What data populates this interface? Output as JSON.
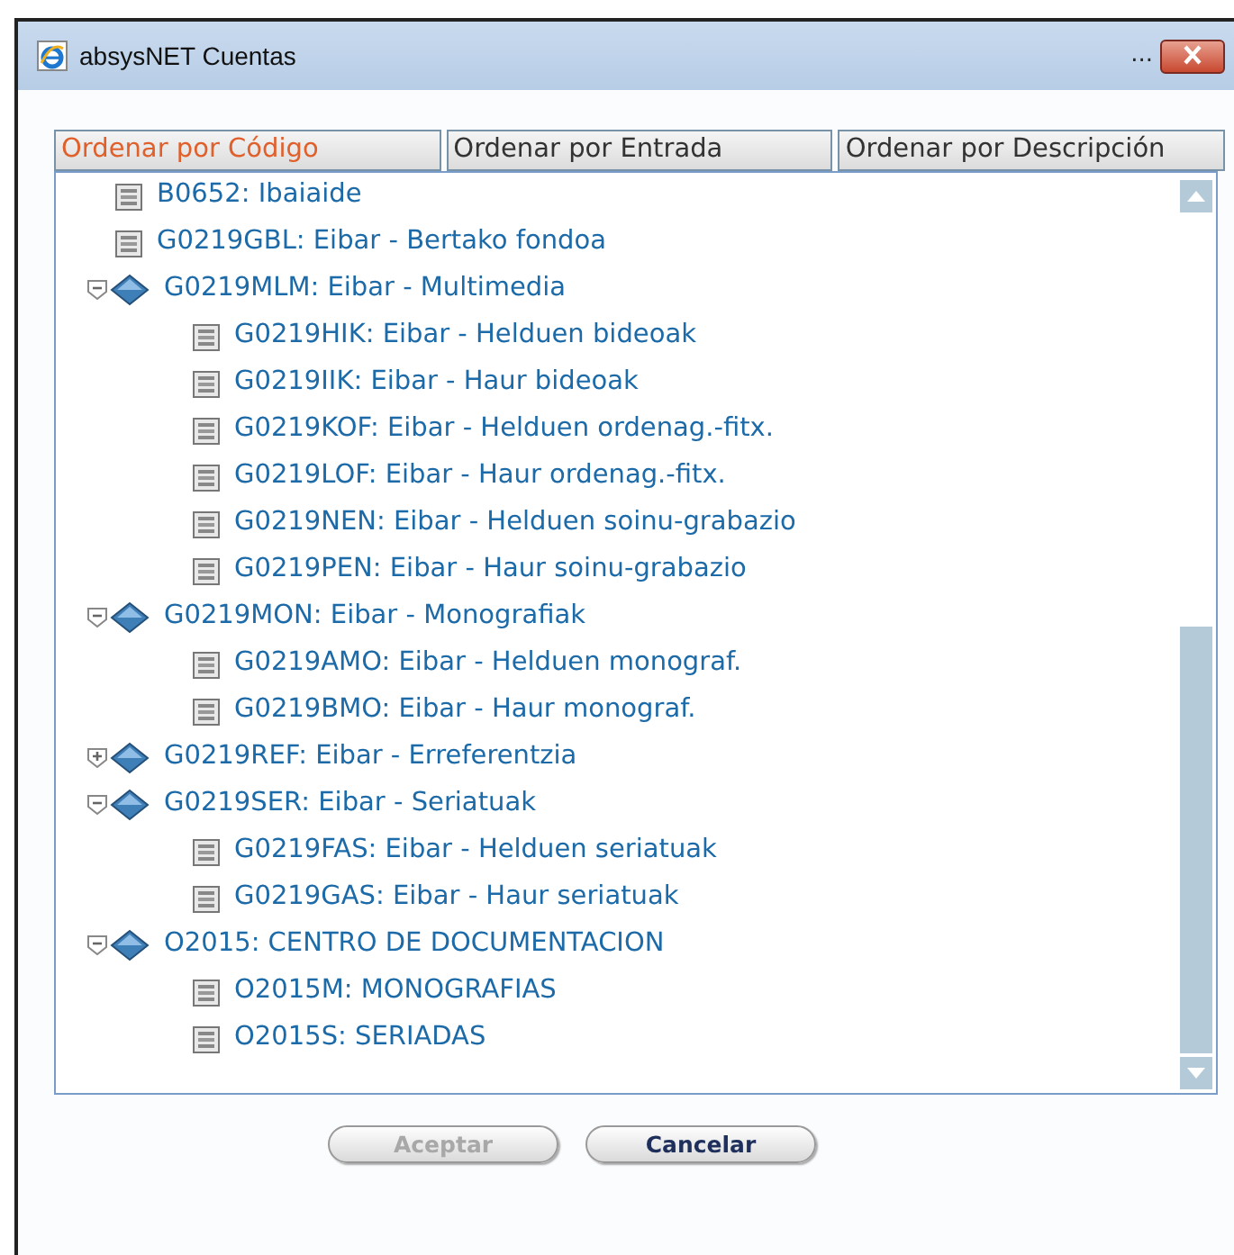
{
  "window": {
    "title": "absysNET Cuentas",
    "ellipsis": "..."
  },
  "tabs": [
    {
      "label": "Ordenar por Código",
      "selected": true
    },
    {
      "label": "Ordenar por Entrada",
      "selected": false
    },
    {
      "label": "Ordenar por Descripción",
      "selected": false
    }
  ],
  "tree": [
    {
      "label": "B0652: Ibaiaide",
      "kind": "leaf"
    },
    {
      "label": "G0219GBL: Eibar - Bertako fondoa",
      "kind": "leaf"
    },
    {
      "label": "G0219MLM: Eibar - Multimedia",
      "kind": "group",
      "expanded": true,
      "children": [
        {
          "label": "G0219HIK: Eibar - Helduen bideoak",
          "kind": "leaf"
        },
        {
          "label": "G0219IIK: Eibar - Haur bideoak",
          "kind": "leaf"
        },
        {
          "label": "G0219KOF: Eibar - Helduen ordenag.-fitx.",
          "kind": "leaf"
        },
        {
          "label": "G0219LOF: Eibar - Haur ordenag.-fitx.",
          "kind": "leaf"
        },
        {
          "label": "G0219NEN: Eibar - Helduen soinu-grabazio",
          "kind": "leaf"
        },
        {
          "label": "G0219PEN: Eibar - Haur soinu-grabazio",
          "kind": "leaf"
        }
      ]
    },
    {
      "label": "G0219MON: Eibar - Monografiak",
      "kind": "group",
      "expanded": true,
      "children": [
        {
          "label": "G0219AMO: Eibar - Helduen monograf.",
          "kind": "leaf"
        },
        {
          "label": "G0219BMO: Eibar - Haur monograf.",
          "kind": "leaf"
        }
      ]
    },
    {
      "label": "G0219REF: Eibar - Erreferentzia",
      "kind": "group",
      "expanded": false
    },
    {
      "label": "G0219SER: Eibar - Seriatuak",
      "kind": "group",
      "expanded": true,
      "children": [
        {
          "label": "G0219FAS: Eibar - Helduen seriatuak",
          "kind": "leaf"
        },
        {
          "label": "G0219GAS: Eibar - Haur seriatuak",
          "kind": "leaf"
        }
      ]
    },
    {
      "label": "O2015: CENTRO DE DOCUMENTACION",
      "kind": "group",
      "expanded": true,
      "children": [
        {
          "label": "O2015M: MONOGRAFIAS",
          "kind": "leaf"
        },
        {
          "label": "O2015S: SERIADAS",
          "kind": "leaf"
        }
      ]
    }
  ],
  "buttons": [
    {
      "label": "Aceptar",
      "disabled": true
    },
    {
      "label": "Cancelar",
      "disabled": false
    }
  ]
}
